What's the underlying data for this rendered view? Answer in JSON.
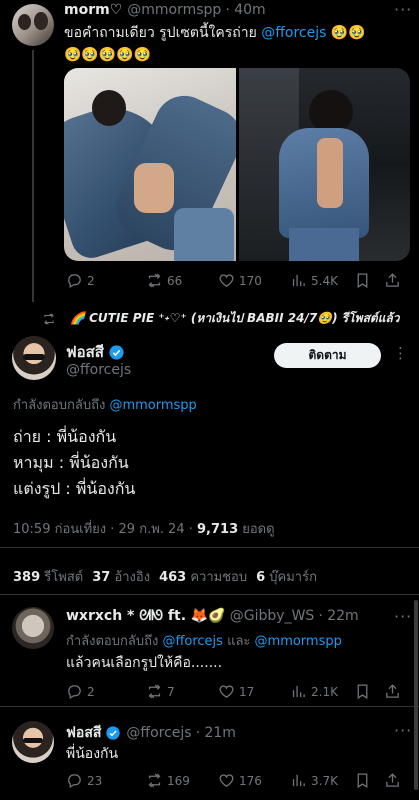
{
  "tweet1": {
    "name": "morm♡",
    "handle": "@mmormspp",
    "time": "· 40m",
    "text_main": "ขอคำถามเดียว รูปเซตนี้ใครถ่าย ",
    "text_mention": "@fforcejs",
    "text_emoji_inline": " 🥹🥹",
    "text_emoji_line2": "🥹🥹🥹🥹🥹",
    "replies": "2",
    "retweets": "66",
    "likes": "170",
    "views": "5.4K"
  },
  "retweet_context": {
    "text": "🌈 CUTIE PIE ⁺˖♡⁺ (หาเงินไป BABII 24/7🥹) รีโพสต์แล้ว"
  },
  "main_tweet": {
    "name": "ฟอสสี",
    "handle": "@fforcejs",
    "follow_label": "ติดตาม",
    "reply_prefix": "กำลังตอบกลับถึง ",
    "reply_to": "@mmormspp",
    "lines": [
      "ถ่าย : พี่น้องกัน",
      "หามุม : พี่น้องกัน",
      "แต่งรูป : พี่น้องกัน"
    ],
    "timestamp": "10:59 ก่อนเที่ยง · 29 ก.พ. 24 · ",
    "view_count": "9,713",
    "view_label": " ยอดดู",
    "stats": [
      {
        "num": "389",
        "label": "รีโพสต์"
      },
      {
        "num": "37",
        "label": "อ้างอิง"
      },
      {
        "num": "463",
        "label": "ความชอบ"
      },
      {
        "num": "6",
        "label": "บุ๊คมาร์ก"
      }
    ]
  },
  "reply1": {
    "name": "wxrxch * ᘛᘚ ft. 🦊🥑",
    "handle": "@Gibby_WS",
    "time": "· 22m",
    "reply_prefix": "กำลังตอบกลับถึง ",
    "reply_to_1": "@fforcejs",
    "reply_and": " และ ",
    "reply_to_2": "@mmormspp",
    "text": "แล้วคนเลือกรูปให้คือ.......",
    "replies": "2",
    "retweets": "7",
    "likes": "17",
    "views": "2.1K"
  },
  "reply2": {
    "name": "ฟอสสี",
    "handle": "@fforcejs",
    "time": "· 21m",
    "text": "พี่น้องกัน",
    "replies": "23",
    "retweets": "169",
    "likes": "176",
    "views": "3.7K"
  },
  "colors": {
    "accent": "#1d9bf0",
    "background": "#000000",
    "muted": "#71767b"
  }
}
